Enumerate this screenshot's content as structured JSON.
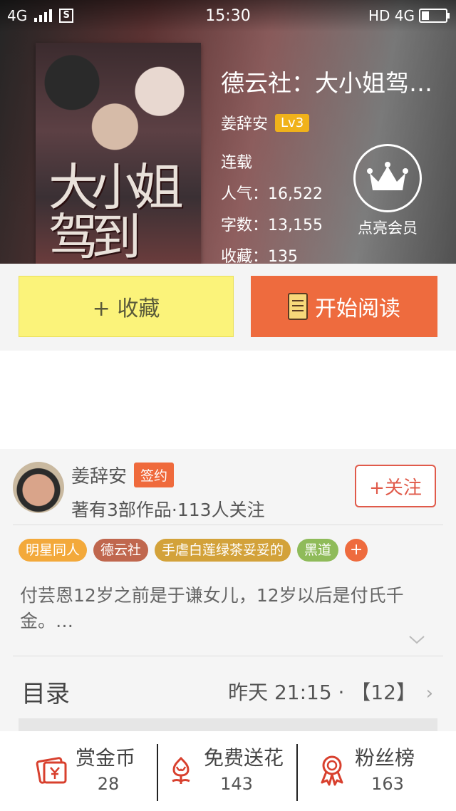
{
  "status_bar": {
    "network_left": "4G",
    "time": "15:30",
    "network_right": "HD 4G"
  },
  "book": {
    "cover_text": "大小姐驾到",
    "title": "德云社：大小姐驾…",
    "author": "姜辞安",
    "level": "Lv3",
    "status": "连载",
    "popularity_label": "人气：",
    "popularity": "16,522",
    "words_label": "字数：",
    "words": "13,155",
    "favorites_label": "收藏：",
    "favorites": "135",
    "member_label": "点亮会员"
  },
  "actions": {
    "favorite_label": "+ 收藏",
    "read_label": "开始阅读"
  },
  "author_card": {
    "name": "姜辞安",
    "badge": "签约",
    "meta": "著有3部作品·113人关注",
    "follow_label": "+关注"
  },
  "tags": [
    {
      "label": "明星同人",
      "color": "#f3a93b"
    },
    {
      "label": "德云社",
      "color": "#c0674e"
    },
    {
      "label": "手虐白莲绿茶妥妥的",
      "color": "#d3a23a"
    },
    {
      "label": "黑道",
      "color": "#8fbb5a"
    },
    {
      "label": "+",
      "color": "#ee6b3e"
    }
  ],
  "description": "付芸恩12岁之前是于谦女儿，12岁以后是付氏千金。…",
  "toc": {
    "label": "目录",
    "latest": "昨天 21:15 · 【12】"
  },
  "bottom_bar": [
    {
      "icon": "reward-coin-icon",
      "label": "赏金币",
      "count": "28"
    },
    {
      "icon": "flower-icon",
      "label": "免费送花",
      "count": "143"
    },
    {
      "icon": "ribbon-badge-icon",
      "label": "粉丝榜",
      "count": "163"
    }
  ],
  "colors": {
    "accent_orange": "#ee6b3e",
    "favorite_yellow": "#fbf37a",
    "level_badge": "#f0b21a",
    "icon_red": "#d8402e"
  }
}
